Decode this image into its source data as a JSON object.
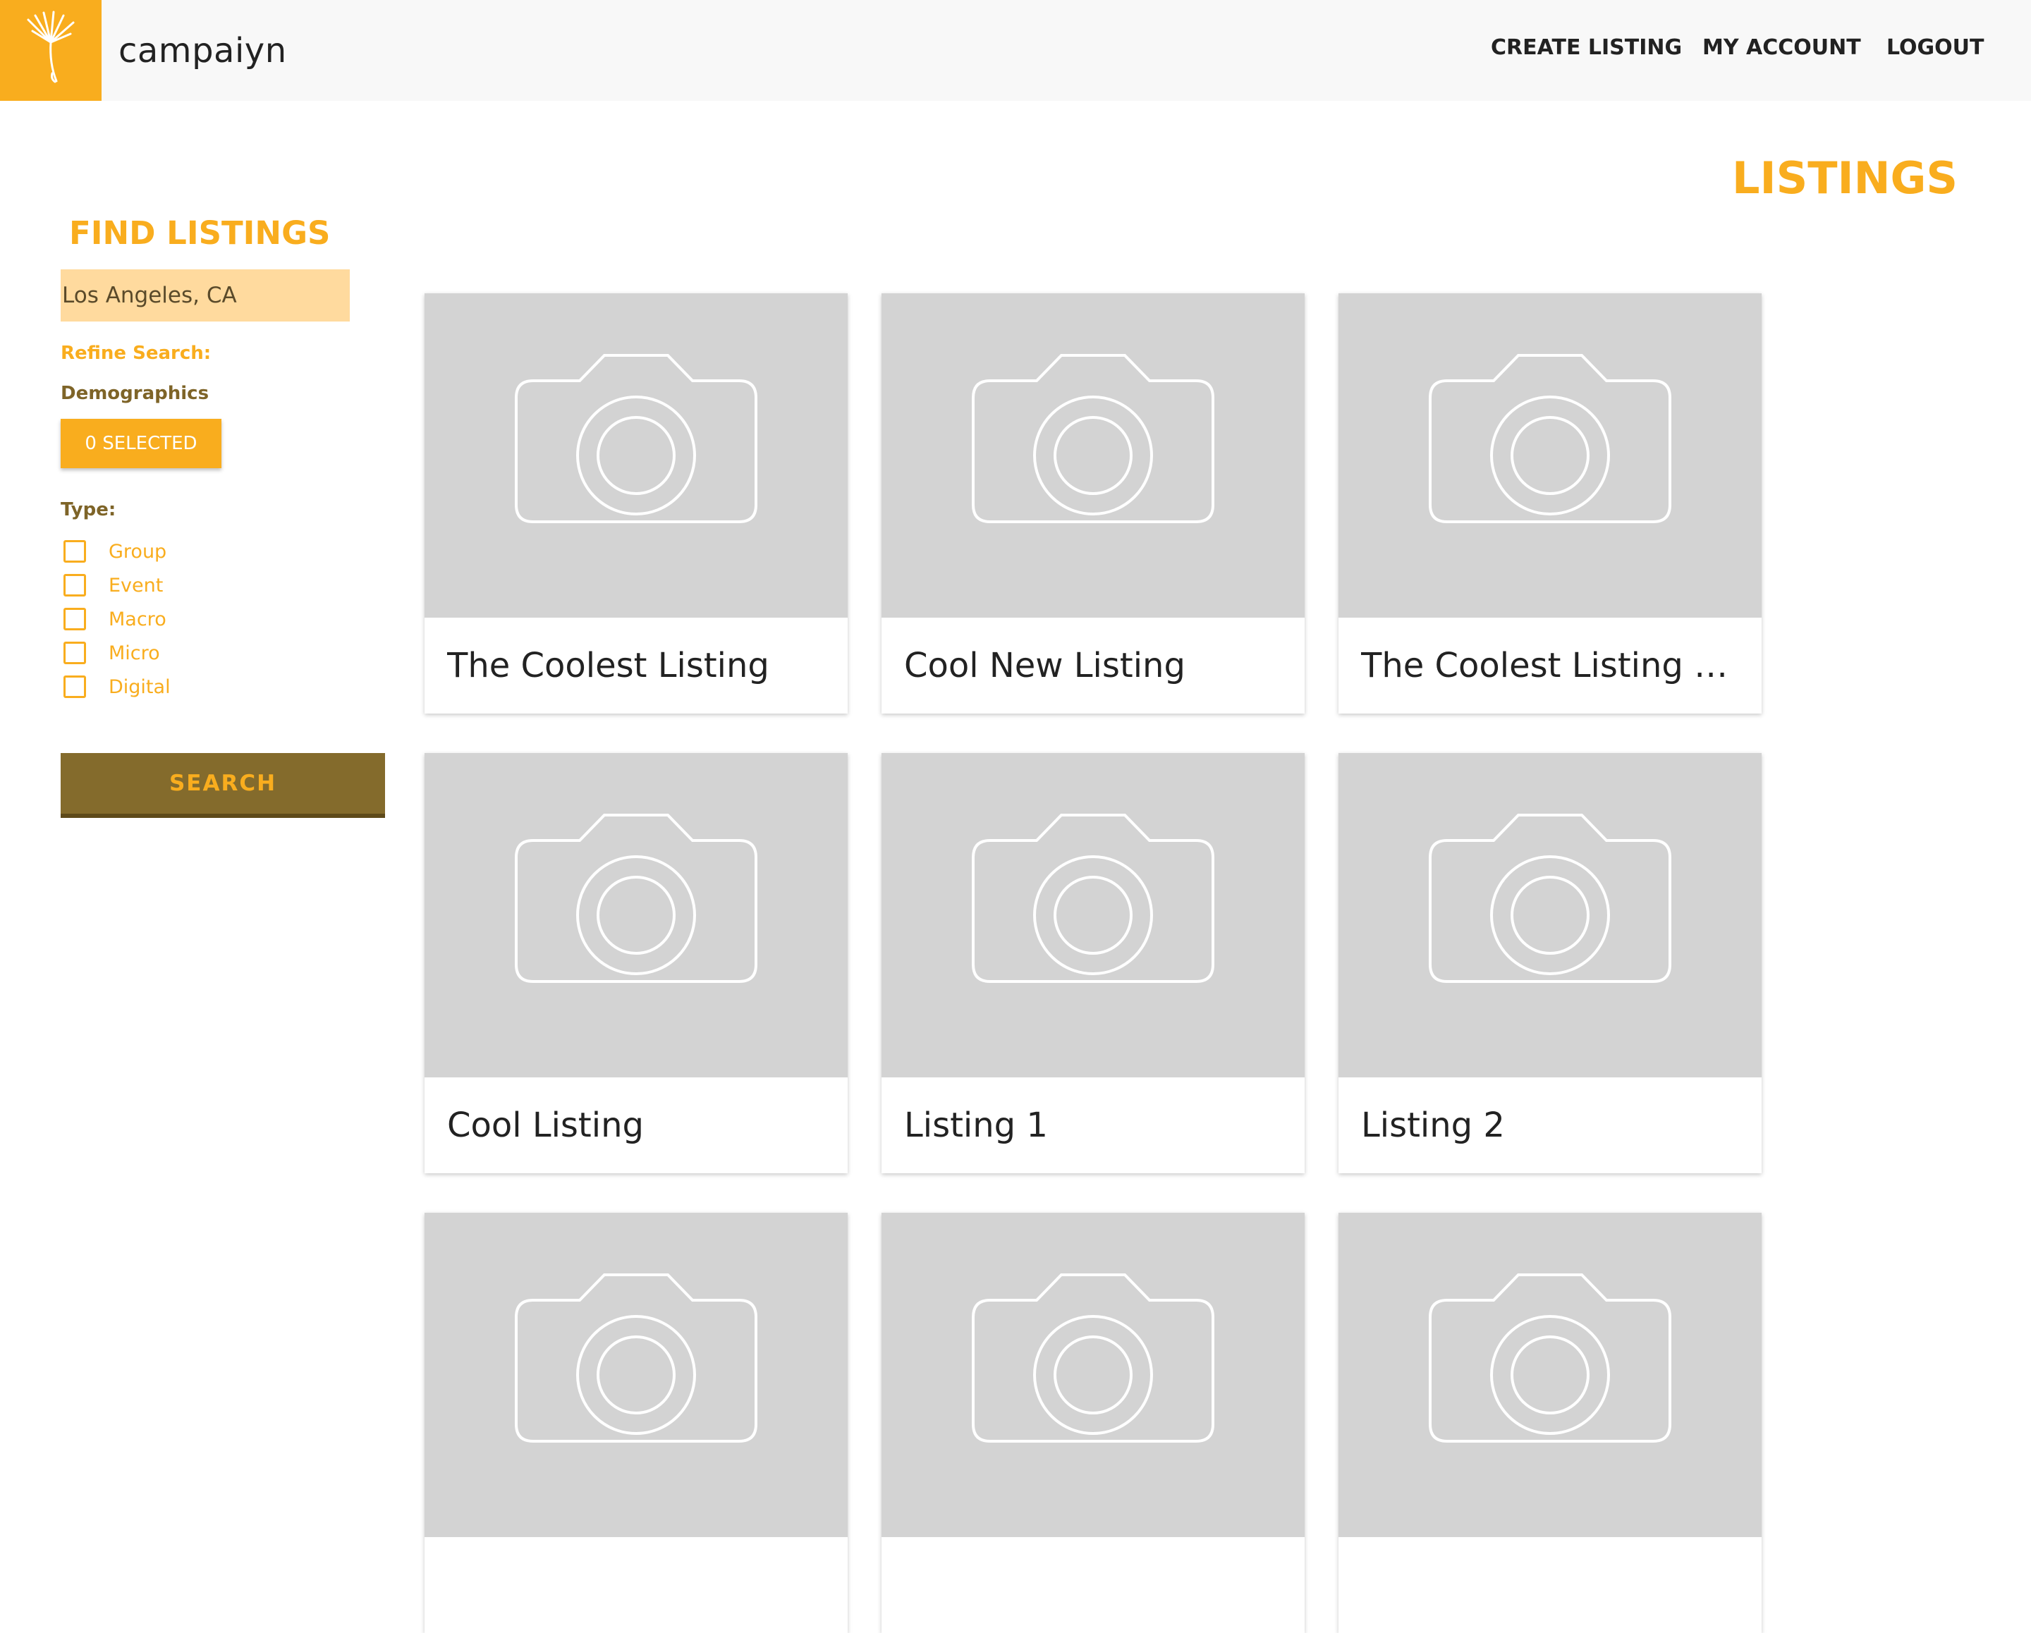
{
  "header": {
    "brand": "campaiyn",
    "logo_icon": "dandelion-seed-icon",
    "nav": [
      "CREATE LISTING",
      "MY ACCOUNT",
      "LOGOUT"
    ]
  },
  "sidebar": {
    "title": "FIND LISTINGS",
    "location_value": "Los Angeles, CA",
    "refine_label": "Refine Search:",
    "demographics_label": "Demographics",
    "demographics_button": "0 SELECTED",
    "type_label": "Type:",
    "types": [
      "Group",
      "Event",
      "Macro",
      "Micro",
      "Digital"
    ],
    "search_button": "SEARCH"
  },
  "main": {
    "title": "LISTINGS",
    "listings": [
      {
        "title": "The Coolest Listing",
        "image_icon": "camera-icon"
      },
      {
        "title": "Cool New Listing",
        "image_icon": "camera-icon"
      },
      {
        "title": "The Coolest Listing Ev…",
        "image_icon": "camera-icon"
      },
      {
        "title": "Cool Listing",
        "image_icon": "camera-icon"
      },
      {
        "title": "Listing 1",
        "image_icon": "camera-icon"
      },
      {
        "title": "Listing 2",
        "image_icon": "camera-icon"
      }
    ]
  },
  "colors": {
    "accent": "#f9ad1e",
    "dark_accent": "#846b2c",
    "input_bg": "#ffda9e",
    "image_placeholder": "#d3d3d3"
  }
}
